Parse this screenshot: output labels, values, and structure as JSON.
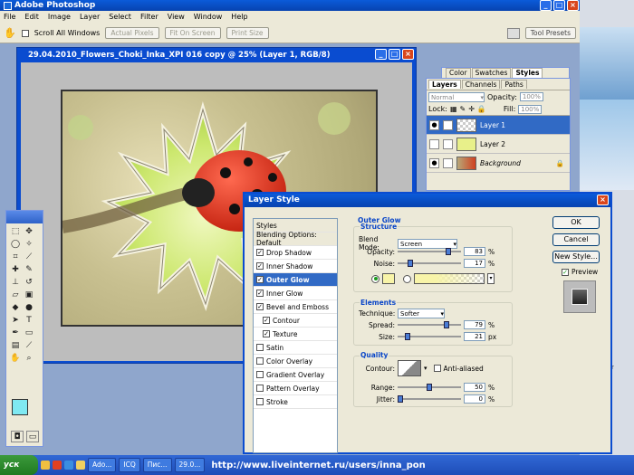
{
  "app": {
    "title": "Adobe Photoshop"
  },
  "menu": [
    "File",
    "Edit",
    "Image",
    "Layer",
    "Select",
    "Filter",
    "View",
    "Window",
    "Help"
  ],
  "options": {
    "scroll_all": "Scroll All Windows",
    "actual_pixels": "Actual Pixels",
    "fit_on_screen": "Fit On Screen",
    "print_size": "Print Size",
    "tool_presets": "Tool Presets"
  },
  "document": {
    "title": "29.04.2010_Flowers_Choki_Inka_XPI 016 copy @ 25% (Layer 1, RGB/8)"
  },
  "palette_tabs_top": [
    "Color",
    "Swatches",
    "Styles"
  ],
  "layers": {
    "tabs": [
      "Layers",
      "Channels",
      "Paths"
    ],
    "blend": "Normal",
    "opacity_label": "Opacity:",
    "opacity": "100%",
    "lock_label": "Lock:",
    "fill_label": "Fill:",
    "fill": "100%",
    "rows": [
      "Layer 1",
      "Layer 2",
      "Background"
    ]
  },
  "dialog": {
    "title": "Layer Style",
    "styles_header": "Styles",
    "blending": "Blending Options: Default",
    "items": [
      {
        "label": "Drop Shadow",
        "checked": true
      },
      {
        "label": "Inner Shadow",
        "checked": true
      },
      {
        "label": "Outer Glow",
        "checked": true,
        "selected": true
      },
      {
        "label": "Inner Glow",
        "checked": true
      },
      {
        "label": "Bevel and Emboss",
        "checked": true
      },
      {
        "label": "Contour",
        "checked": true,
        "sub": true
      },
      {
        "label": "Texture",
        "checked": true,
        "sub": true
      },
      {
        "label": "Satin",
        "checked": false
      },
      {
        "label": "Color Overlay",
        "checked": false
      },
      {
        "label": "Gradient Overlay",
        "checked": false
      },
      {
        "label": "Pattern Overlay",
        "checked": false
      },
      {
        "label": "Stroke",
        "checked": false
      }
    ],
    "section": "Outer Glow",
    "structure": "Structure",
    "blend_mode_label": "Blend Mode:",
    "blend_mode": "Screen",
    "opacity_label": "Opacity:",
    "opacity": "83",
    "noise_label": "Noise:",
    "noise": "17",
    "elements": "Elements",
    "technique_label": "Technique:",
    "technique": "Softer",
    "spread_label": "Spread:",
    "spread": "79",
    "size_label": "Size:",
    "size": "21",
    "quality": "Quality",
    "contour_label": "Contour:",
    "anti_aliased": "Anti-aliased",
    "range_label": "Range:",
    "range": "50",
    "jitter_label": "Jitter:",
    "jitter": "0",
    "pct": "%",
    "px": "px",
    "ok": "OK",
    "cancel": "Cancel",
    "new_style": "New Style...",
    "preview": "Preview"
  },
  "taskbar": {
    "start": "уск",
    "items": [
      "Ado...",
      "ICQ",
      "Пис...",
      "29.0..."
    ],
    "url": "http://www.liveinternet.ru/users/inna_pon"
  },
  "side": {
    "text": "ramefer"
  },
  "colors": {
    "titlebar": "#0743b0",
    "accent": "#316ac5",
    "fg_swatch": "#7fe9f2",
    "bg_swatch": "#f8f4a8"
  }
}
